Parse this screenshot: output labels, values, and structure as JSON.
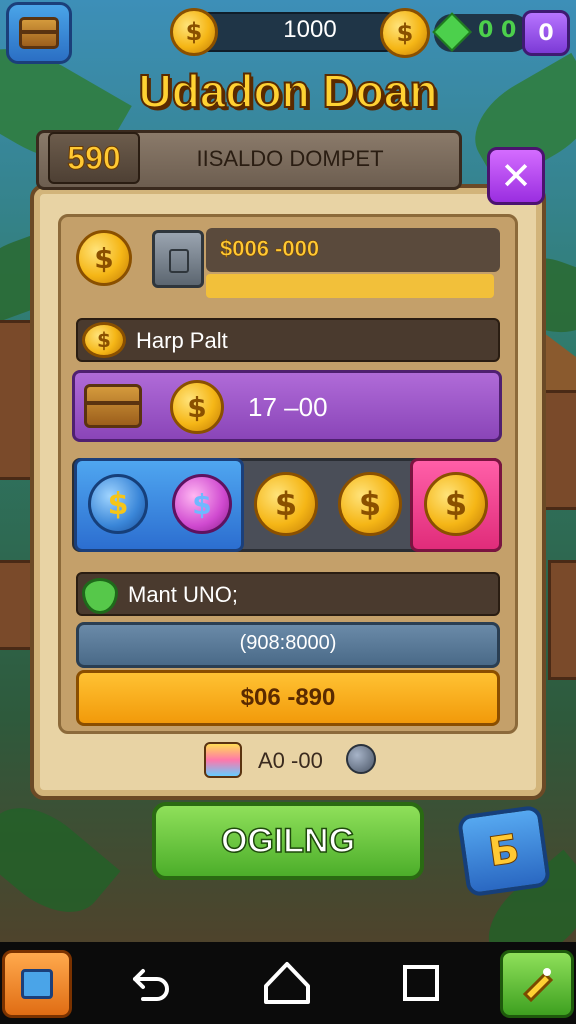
{
  "top_bar": {
    "coin_left_symbol": "$",
    "currency_value": "1000",
    "coin_right_symbol": "$",
    "gem_value": "0 0",
    "purple_button_label": "0"
  },
  "title": "Udadon Doan",
  "dialog": {
    "banner_number": "590",
    "banner_title": "IISALDO DOMPET",
    "close_label": "✕",
    "row1": {
      "coin_symbol": "$",
      "value": "$006 -000"
    },
    "section2": {
      "coin_symbol": "$",
      "label": "Harp Palt",
      "coin2_symbol": "$",
      "value": "17 –00"
    },
    "coin_row": {
      "blue_coin_symbol": "$",
      "pink_coin_symbol": "$",
      "gold_coins": [
        "$",
        "$",
        "$"
      ]
    },
    "section3": {
      "label": "Mant UNO;",
      "value1": "(908:8000)",
      "value2": "$06 -890"
    },
    "footer_value": "A0 -00"
  },
  "action_button_label": "OGILNG",
  "side_button_label": "Б",
  "navbar": {
    "back_icon": "back-arrow-icon",
    "home_icon": "home-outline-icon",
    "recents_icon": "recents-square-icon",
    "green_button_icon": "ticket-icon"
  }
}
